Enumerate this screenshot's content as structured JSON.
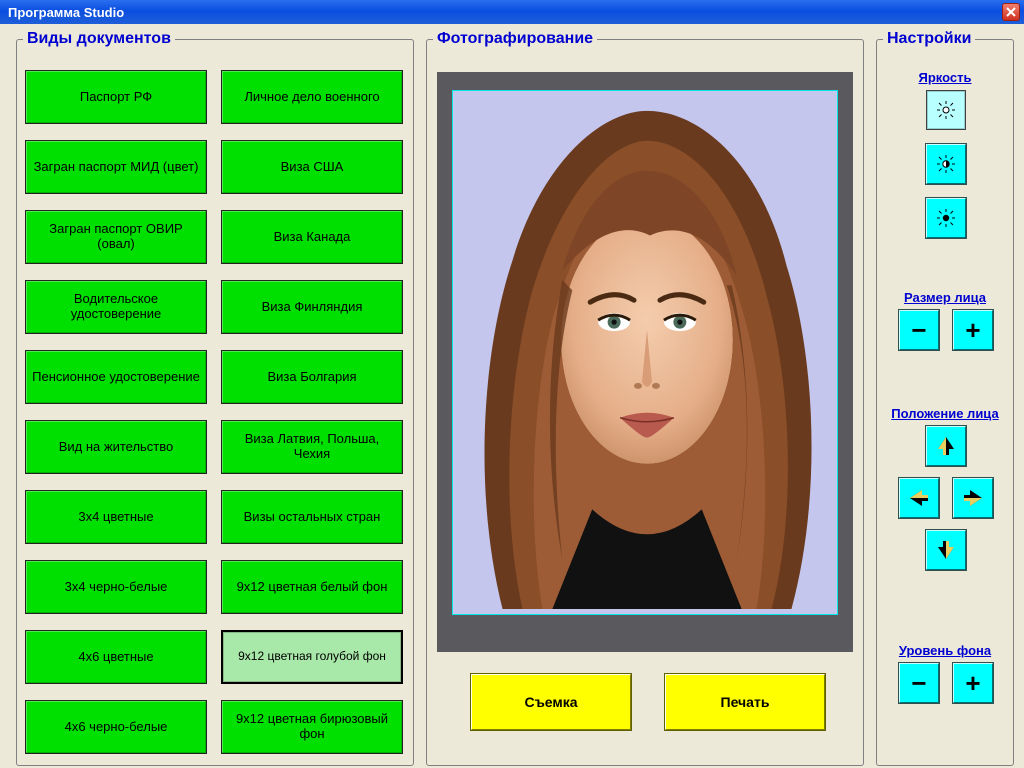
{
  "window": {
    "title": "Программа Studio"
  },
  "docs": {
    "title": "Виды документов",
    "buttons": [
      "Паспорт РФ",
      "Личное дело военного",
      "Загран паспорт МИД (цвет)",
      "Виза США",
      "Загран паспорт ОВИР (овал)",
      "Виза Канада",
      "Водительское удостоверение",
      "Виза Финляндия",
      "Пенсионное удостоверение",
      "Виза Болгария",
      "Вид на жительство",
      "Виза Латвия, Польша, Чехия",
      "3x4 цветные",
      "Визы остальных стран",
      "3x4 черно-белые",
      "9x12 цветная белый фон",
      "4x6 цветные",
      "9x12 цветная голубой фон",
      "4x6 черно-белые",
      "9х12 цветная бирюзовый фон"
    ],
    "selected_index": 17
  },
  "photo": {
    "title": "Фотографирование",
    "shoot": "Съемка",
    "print": "Печать"
  },
  "settings": {
    "title": "Настройки",
    "brightness_label": "Яркость",
    "face_size_label": "Размер лица",
    "face_pos_label": "Положение лица",
    "bg_level_label": "Уровень фона",
    "brightness_selected": 0
  },
  "colors": {
    "accent_green": "#00e000",
    "accent_cyan": "#00ffff",
    "accent_yellow": "#ffff00",
    "heading": "#0000d0"
  }
}
